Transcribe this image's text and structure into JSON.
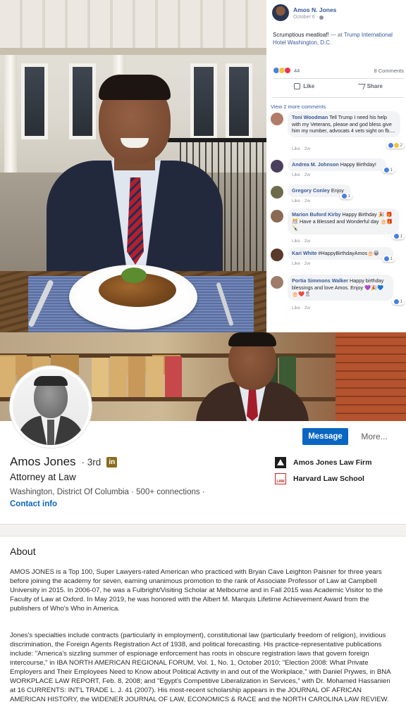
{
  "facebook": {
    "author": "Amos N. Jones",
    "date": "October 6",
    "status_text": "Scrumptious meatloaf!",
    "status_at": "— at",
    "status_place": "Trump International Hotel Washington, D.C.",
    "reaction_count": "44",
    "comment_count": "8 Comments",
    "like_label": "Like",
    "share_label": "Share",
    "view_more": "View 2 more comments",
    "comments": [
      {
        "author": "Toni Woodman",
        "text": "Tell Trump I need his help with my Veterans, please and god bless give him my number, advocats 4 vets sight on fb....",
        "meta": "Like · 2w",
        "rx": "2"
      },
      {
        "author": "Andrea M. Johnson",
        "text": "Happy Birthday!",
        "meta": "Like · 2w",
        "rx": "1"
      },
      {
        "author": "Gregory Conley",
        "text": "Enjoy",
        "meta": "Like · 2w",
        "rx": "1"
      },
      {
        "author": "Marion Buford Kirby",
        "text": "Happy Birthday 🎉 🎁🎊 Have a Blessed and Wonderful day 🎂🎁🍾",
        "meta": "Like · 2w",
        "rx": "1"
      },
      {
        "author": "Kari White",
        "text": "#HappyBirthdayAmos🎂😀",
        "meta": "Like · 2w",
        "rx": "1"
      },
      {
        "author": "Portia Simmons Walker",
        "text": "Happy birthday blessings and love Amos. Enjoy 💜🎉💙🎂❤️🎗",
        "meta": "Like · 2w",
        "rx": "1"
      }
    ]
  },
  "linkedin": {
    "message_label": "Message",
    "more_label": "More...",
    "name": "Amos Jones",
    "degree": "· 3rd",
    "in_badge": "in",
    "headline": "Attorney at Law",
    "location": "Washington, District Of Columbia · 500+ connections ·",
    "contact": "Contact info",
    "company": "Amos Jones Law Firm",
    "school": "Harvard Law School",
    "school_badge": "LAW",
    "about_title": "About",
    "about_p1": "AMOS JONES is a Top 100, Super Lawyers-rated American who practiced with Bryan Cave Leighton Paisner for three years before joining the academy for seven, earning unanimous promotion to the rank of Associate Professor of Law at Campbell University in 2015. In 2006-07, he was a Fulbright/Visiting Scholar at Melbourne and in Fall 2015 was Academic Visitor to the Faculty of Law at Oxford. In May 2019, he was honored with the Albert M. Marquis Lifetime Achievement Award from the publishers of Who's Who in America.",
    "about_p2": "Jones's specialties include contracts (particularly in employment), constitutional law (particularly freedom of religion), invidious discrimination, the Foreign Agents Registration Act of 1938, and political forecasting. His practice-representative publications include: \"America's sizzling summer of espionage enforcement has roots in obscure registration laws that govern foreign intercourse,\" in IBA NORTH AMERICAN REGIONAL FORUM, Vol. 1, No. 1, October 2010; \"Election 2008: What Private Employers and Their Employees Need to Know about Political Activity in and out of the Workplace,\" with Daniel Prywes, in BNA WORKPLACE LAW REPORT, Feb. 8, 2008; and \"Egypt's Competitive Liberalization in Services,\" with Dr. Mohamed Hassanien at 16 CURRENTS: INT'L TRADE L. J. 41 (2007). His most-recent scholarship appears in the JOURNAL OF AFRICAN AMERICAN HISTORY, the WIDENER JOURNAL OF LAW, ECONOMICS & RACE and the NORTH CAROLINA LAW REVIEW."
  },
  "colors": {
    "fb_link": "#385898",
    "li_blue": "#0a66c2",
    "li_premium": "#8a6d1e"
  }
}
